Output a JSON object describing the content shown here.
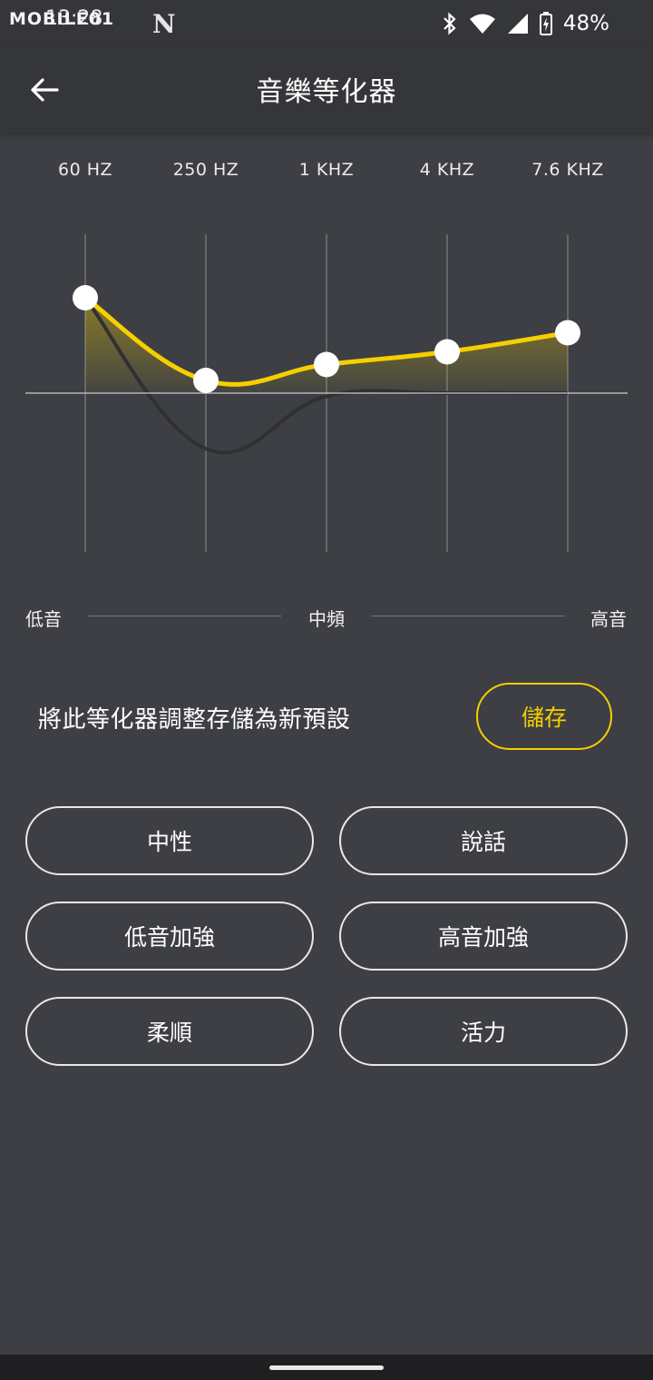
{
  "status_bar": {
    "time": "13:28",
    "watermark": "MOBILE01",
    "battery_percent": "48%",
    "icons": [
      "netflix-icon",
      "bluetooth-icon",
      "wifi-icon",
      "signal-icon",
      "battery-charging-icon"
    ]
  },
  "app_bar": {
    "title": "音樂等化器",
    "back_icon": "arrow-left-icon"
  },
  "equalizer": {
    "bands": [
      "60 HZ",
      "250 HZ",
      "1 KHZ",
      "4 KHZ",
      "7.6 KHZ"
    ],
    "band_levels": [
      0.6,
      0.08,
      0.18,
      0.26,
      0.38
    ],
    "reference_levels": [
      0.6,
      -0.35,
      -0.02,
      0.0,
      0.0
    ],
    "accent_color": "#f5cf00"
  },
  "range": {
    "low": "低音",
    "mid": "中頻",
    "high": "高音"
  },
  "save": {
    "prompt": "將此等化器調整存儲為新預設",
    "button_label": "儲存"
  },
  "presets": [
    "中性",
    "說話",
    "低音加強",
    "高音加強",
    "柔順",
    "活力"
  ]
}
